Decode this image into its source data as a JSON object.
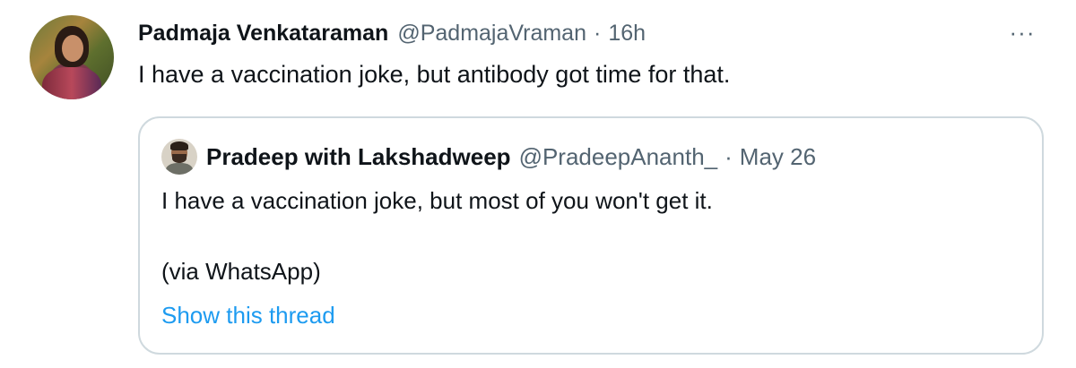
{
  "tweet": {
    "author_name": "Padmaja Venkataraman",
    "author_handle": "@PadmajaVraman",
    "separator": "·",
    "time": "16h",
    "more_label": "···",
    "text": "I have a vaccination joke, but antibody got time for that."
  },
  "quoted": {
    "author_name": "Pradeep with Lakshadweep",
    "author_handle": "@PradeepAnanth_",
    "separator": "·",
    "time": "May 26",
    "line1": "I have a vaccination joke, but most of you won't get it.",
    "line2": "(via WhatsApp)",
    "show_thread": "Show this thread"
  },
  "colors": {
    "text_primary": "#0f1419",
    "text_secondary": "#536471",
    "link": "#1d9bf0",
    "border": "#cfd9de"
  },
  "icons": {
    "more": "more-horizontal-icon"
  }
}
